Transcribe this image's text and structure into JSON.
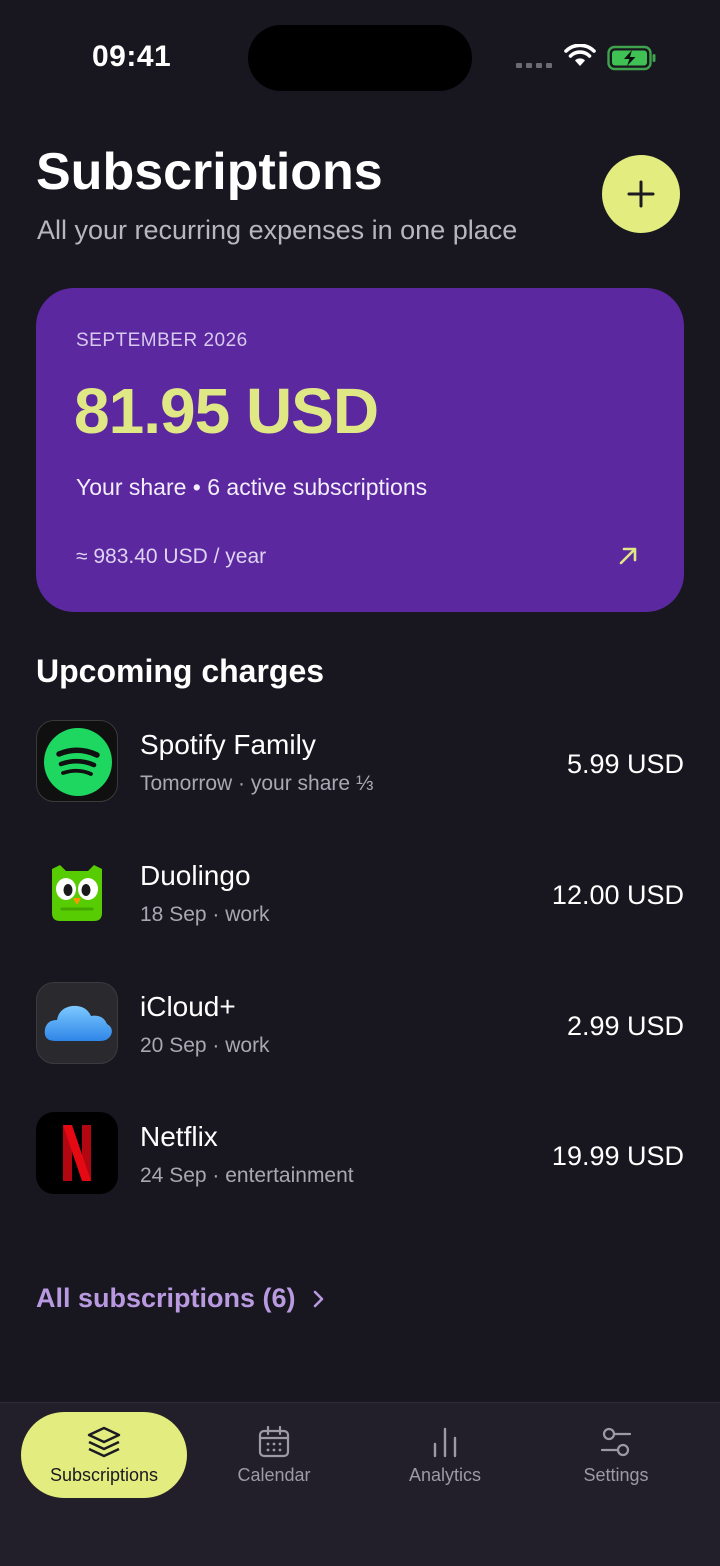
{
  "status_bar": {
    "time": "09:41"
  },
  "header": {
    "title": "Subscriptions",
    "subtitle": "All your recurring expenses in one place"
  },
  "summary": {
    "month": "SEPTEMBER 2026",
    "amount": "81.95 USD",
    "share_text": "Your share • 6 active subscriptions",
    "yearly": "≈ 983.40 USD / year"
  },
  "upcoming": {
    "title": "Upcoming charges",
    "items": [
      {
        "name": "Spotify Family",
        "meta": "Tomorrow · your share ⅓",
        "price": "5.99 USD",
        "icon": "spotify-logo"
      },
      {
        "name": "Duolingo",
        "meta": "18 Sep · work",
        "price": "12.00 USD",
        "icon": "duolingo-logo"
      },
      {
        "name": "iCloud+",
        "meta": "20 Sep · work",
        "price": "2.99 USD",
        "icon": "icloud-logo"
      },
      {
        "name": "Netflix",
        "meta": "24 Sep · entertainment",
        "price": "19.99 USD",
        "icon": "netflix-logo"
      }
    ],
    "all_link": "All subscriptions (6)"
  },
  "tabs": [
    {
      "label": "Subscriptions",
      "icon": "layers-icon",
      "active": true
    },
    {
      "label": "Calendar",
      "icon": "calendar-icon",
      "active": false
    },
    {
      "label": "Analytics",
      "icon": "bar-chart-icon",
      "active": false
    },
    {
      "label": "Settings",
      "icon": "sliders-icon",
      "active": false
    }
  ],
  "colors": {
    "background": "#18161f",
    "accent": "#e3ec7e",
    "card": "#5b28a0",
    "link": "#b99ae0"
  }
}
